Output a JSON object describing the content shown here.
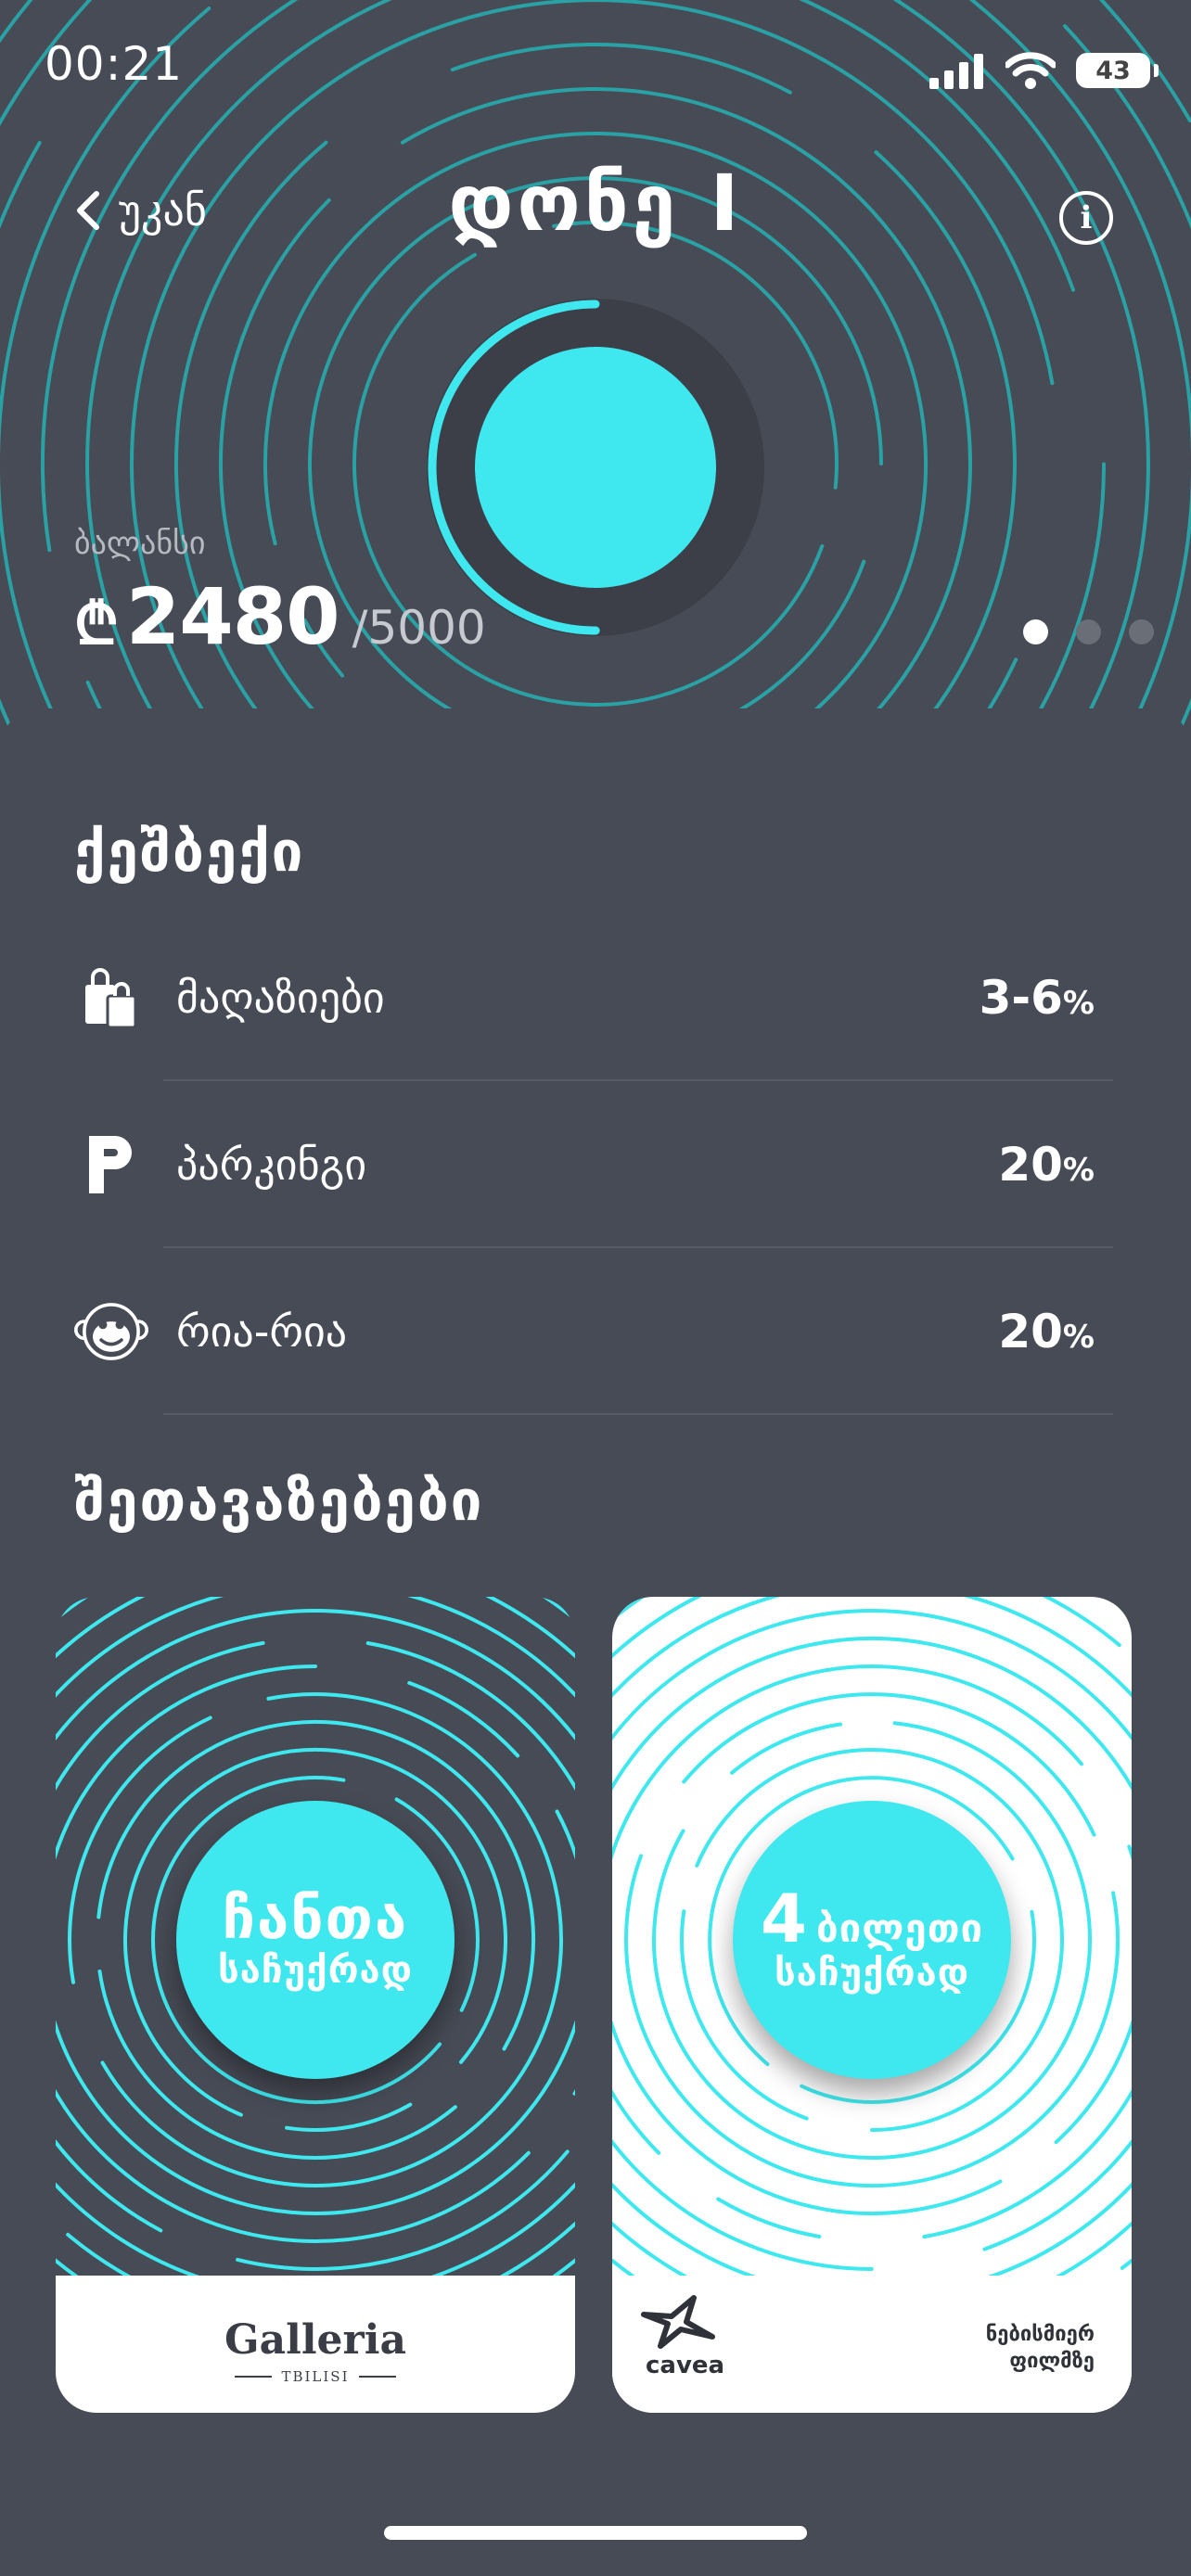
{
  "colors": {
    "background": "#474b55",
    "accent": "#3ee8ee",
    "ring_dark": "#2aa1a4",
    "white": "#ffffff"
  },
  "status_bar": {
    "time": "00:21",
    "battery": "43",
    "icons": [
      "cellular-signal-icon",
      "wifi-icon",
      "battery-icon"
    ]
  },
  "header": {
    "back_label": "უკან",
    "title": "დონე I",
    "icons": [
      "chevron-left-icon",
      "info-icon"
    ]
  },
  "balance": {
    "label": "ბალანსი",
    "currency_symbol": "₾",
    "value": "2480",
    "max": "/5000",
    "progress_fraction": 0.5
  },
  "pager": {
    "pages": 3,
    "active_index": 0
  },
  "cashback": {
    "title": "ქეშბექი",
    "items": [
      {
        "icon": "shopping-bags-icon",
        "label": "მაღაზიები",
        "value": "3-6",
        "unit": "%"
      },
      {
        "icon": "parking-icon",
        "label": "პარკინგი",
        "value": "20",
        "unit": "%"
      },
      {
        "icon": "monkey-face-icon",
        "label": "რია-რია",
        "value": "20",
        "unit": "%"
      }
    ]
  },
  "offers": {
    "title": "შეთავაზებები",
    "cards": [
      {
        "badge_line1": "ჩანთა",
        "badge_line2": "საჩუქრად",
        "partner_name": "Galleria",
        "partner_sub": "TBILISI"
      },
      {
        "badge_number": "4",
        "badge_line1": "ბილეთი",
        "badge_line2": "საჩუქრად",
        "partner_name": "cavea",
        "partner_note_1": "ნებისმიერ",
        "partner_note_2": "ფილმზე"
      }
    ]
  }
}
